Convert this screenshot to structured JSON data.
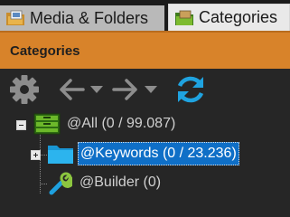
{
  "tabs": [
    {
      "label": "Media & Folders",
      "icon": "folder-images-icon",
      "active": false
    },
    {
      "label": "Categories",
      "icon": "green-folder-icon",
      "active": true
    }
  ],
  "panel": {
    "title": "Categories"
  },
  "toolbar": {
    "settings_icon": "gear-icon",
    "back_icon": "arrow-left-icon",
    "forward_icon": "arrow-right-icon",
    "refresh_icon": "refresh-icon"
  },
  "tree": {
    "items": [
      {
        "label": "@All (0 / 99.087)",
        "icon": "database-icon",
        "expanded": true
      },
      {
        "label": "@Keywords (0 / 23.236)",
        "icon": "folder-icon",
        "expanded": false,
        "selected": true
      },
      {
        "label": "@Builder (0)",
        "icon": "wrench-icon"
      }
    ]
  },
  "colors": {
    "header": "#d8832a",
    "selection": "#0f6fc7",
    "refresh": "#1fa3e0",
    "background": "#262626"
  }
}
